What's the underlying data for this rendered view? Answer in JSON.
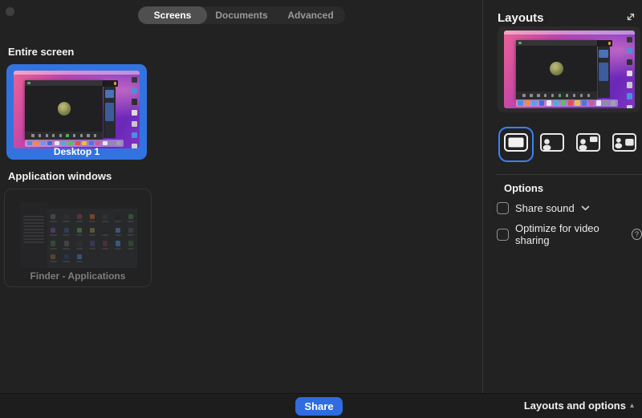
{
  "tabs": {
    "selected": "Screens",
    "items": [
      {
        "label": "Screens"
      },
      {
        "label": "Documents"
      },
      {
        "label": "Advanced"
      }
    ]
  },
  "main": {
    "entire_screen_heading": "Entire screen",
    "desktop_tile_label": "Desktop 1",
    "application_windows_heading": "Application windows",
    "app_tile_label": "Finder - Applications",
    "selected_source": "Desktop 1"
  },
  "sidebar": {
    "heading": "Layouts",
    "selected_layout_index": 0,
    "options_heading": "Options",
    "share_sound_label": "Share sound",
    "optimize_label": "Optimize for video sharing",
    "help_glyph": "?"
  },
  "footer": {
    "share_button": "Share",
    "layouts_toggle": "Layouts and options",
    "chevron_up_glyph": "▴"
  },
  "colors": {
    "accent_blue": "#2e6ce0",
    "selection_blue": "#3273e0",
    "layout_ring_blue": "#3b82f6",
    "background": "#222222"
  },
  "thumbnails": {
    "zoom_toolbar_active_color": "#58a85e",
    "zoom_toolbar_dot_color": "#8e8e92",
    "dock_colors": [
      "#4a90e2",
      "#e8913a",
      "#5aa0e8",
      "#3a6fd8",
      "#e8e8ea",
      "#48b0e0",
      "#58c060",
      "#e05050",
      "#e8c040",
      "#4a78d8",
      "#d05898",
      "#e8e8ea",
      "#8a92a0",
      "#9aa2b0"
    ],
    "desktop_icon_colors": [
      "#36363a",
      "#4a8fe0",
      "#2f2f33",
      "#dcdcde",
      "#c8c8ca",
      "#4a8fe0",
      "#d0d0d2"
    ],
    "finder_icon_colors": [
      "#6a6a6e",
      "#3a3a3e",
      "#8a4a42",
      "#c46a32",
      "#42423e",
      "#2a2a2e",
      "#4a7a52",
      "#7a52a2",
      "#3a5a8a",
      "#52a262",
      "#8a8a52",
      "#2e2e32",
      "#5a8ac2",
      "#52525a",
      "#42724a",
      "#62626a",
      "#3a3a42",
      "#4a4a8a",
      "#7a3a3a",
      "#4a90d8",
      "#3a6a3a",
      "#8a6a3a",
      "#2a4a6a",
      "#4a80c8"
    ]
  }
}
